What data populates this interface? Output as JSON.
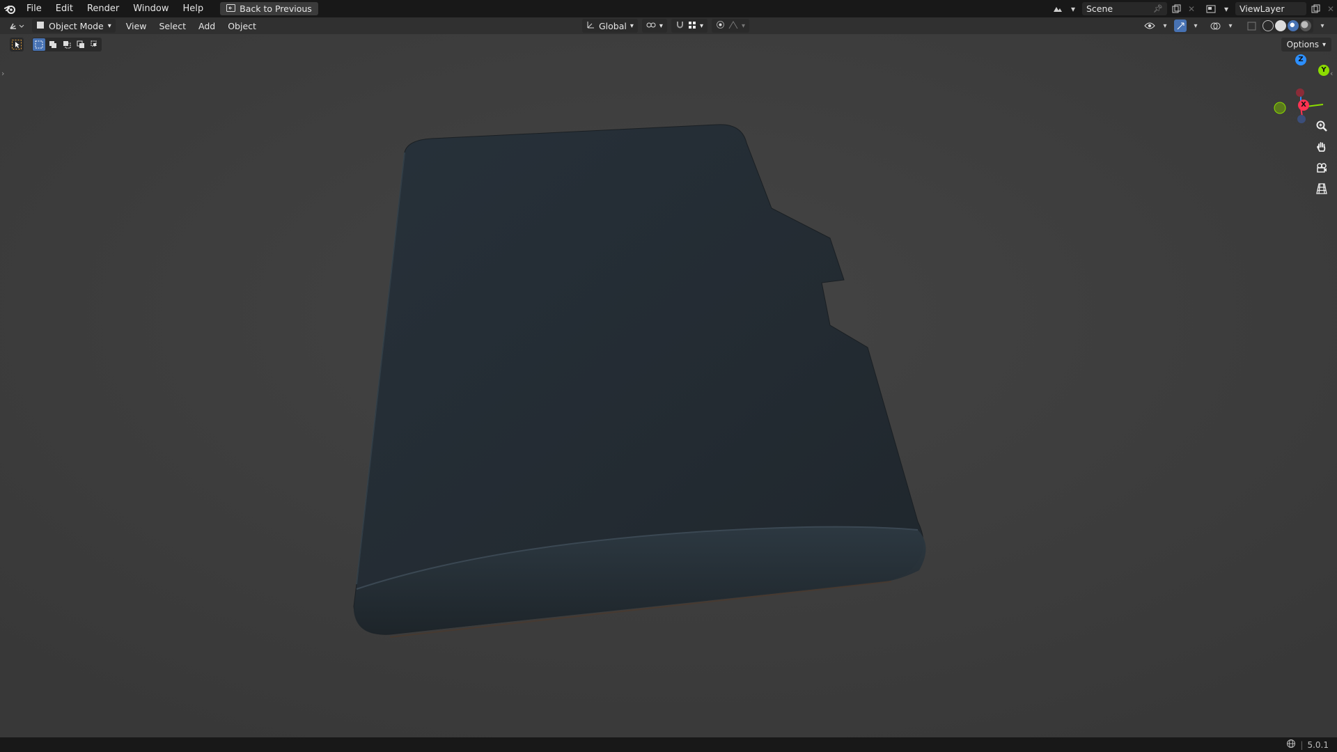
{
  "topbar": {
    "menus": [
      "File",
      "Edit",
      "Render",
      "Window",
      "Help"
    ],
    "back_label": "Back to Previous",
    "scene_label": "Scene",
    "view_layer_label": "ViewLayer"
  },
  "header": {
    "mode_label": "Object Mode",
    "menus": [
      "View",
      "Select",
      "Add",
      "Object"
    ],
    "orientation_label": "Global"
  },
  "toolrow": {
    "options_label": "Options"
  },
  "gizmo": {
    "axes": {
      "z": "Z",
      "y": "Y",
      "x": "X"
    },
    "colors": {
      "z": "#2c8fff",
      "y": "#8bdc00",
      "x": "#ff3352"
    }
  },
  "nav_icons": [
    "zoom-icon",
    "pan-hand-icon",
    "camera-icon",
    "perspective-grid-icon"
  ],
  "colors": {
    "viewport_bg": "#3d3d3d",
    "object_fill": "#252e35",
    "accent": "#4772b3"
  },
  "status": {
    "version": "5.0.1"
  }
}
